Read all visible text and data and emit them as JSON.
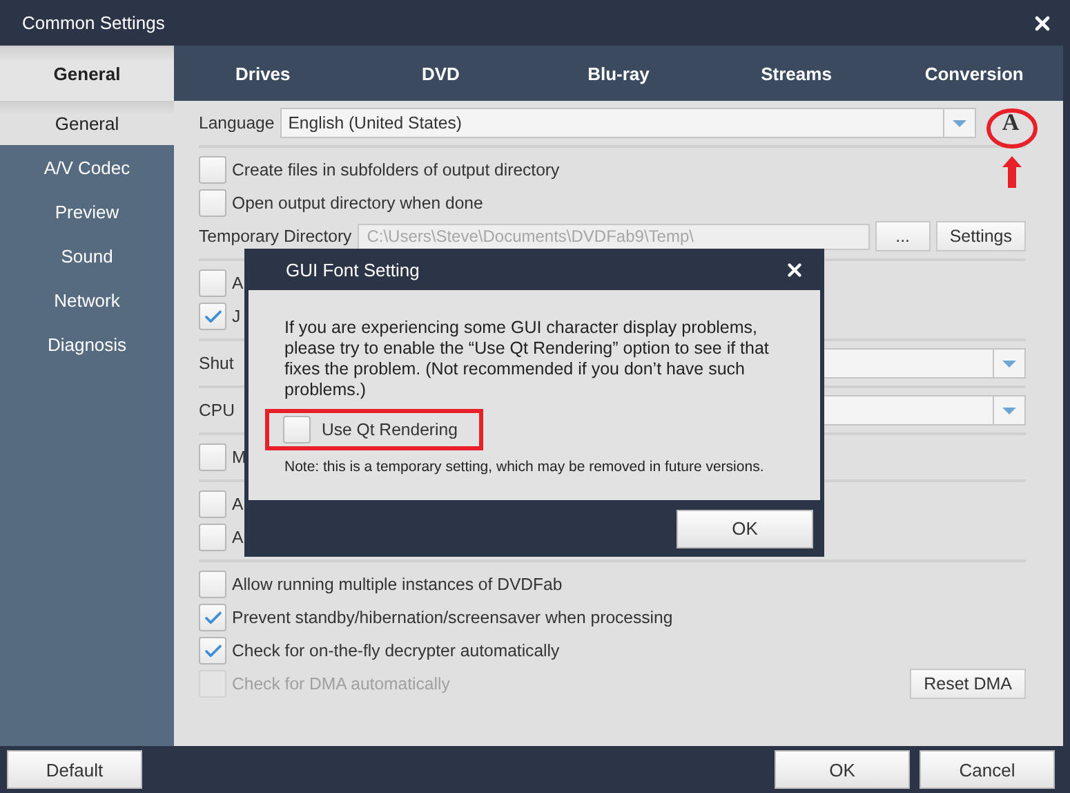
{
  "window": {
    "title": "Common Settings"
  },
  "tabs": [
    {
      "label": "General",
      "selected": true
    },
    {
      "label": "Drives",
      "selected": false
    },
    {
      "label": "DVD",
      "selected": false
    },
    {
      "label": "Blu-ray",
      "selected": false
    },
    {
      "label": "Streams",
      "selected": false
    },
    {
      "label": "Conversion",
      "selected": false
    }
  ],
  "sidebar": {
    "items": [
      {
        "label": "General",
        "selected": true
      },
      {
        "label": "A/V Codec",
        "selected": false
      },
      {
        "label": "Preview",
        "selected": false
      },
      {
        "label": "Sound",
        "selected": false
      },
      {
        "label": "Network",
        "selected": false
      },
      {
        "label": "Diagnosis",
        "selected": false
      }
    ]
  },
  "groups": [
    [
      {
        "kind": "select",
        "label": "Language",
        "value": "English (United States)",
        "font_button": "A"
      }
    ],
    [
      {
        "kind": "checkbox",
        "label": "Create files in subfolders of output directory",
        "checked": false,
        "disabled": false
      },
      {
        "kind": "checkbox",
        "label": "Open output directory when done",
        "checked": false,
        "disabled": false
      },
      {
        "kind": "directory",
        "label": "Temporary Directory",
        "value": "C:\\Users\\Steve\\Documents\\DVDFab9\\Temp\\",
        "buttons": [
          "...",
          "Settings"
        ]
      }
    ],
    [
      {
        "kind": "checkbox",
        "label": "A",
        "checked": false,
        "disabled": false
      },
      {
        "kind": "checkbox",
        "label": "J",
        "checked": true,
        "disabled": false
      }
    ],
    [
      {
        "kind": "select",
        "label": "Shut"
      }
    ],
    [
      {
        "kind": "select",
        "label": "CPU"
      }
    ],
    [
      {
        "kind": "checkbox",
        "label": "M",
        "checked": false,
        "disabled": false
      }
    ],
    [
      {
        "kind": "checkbox",
        "label": "A",
        "checked": false,
        "disabled": false
      },
      {
        "kind": "checkbox",
        "label": "A",
        "checked": false,
        "disabled": false
      }
    ],
    [
      {
        "kind": "checkbox",
        "label": "Allow running multiple instances of DVDFab",
        "checked": false,
        "disabled": false
      },
      {
        "kind": "checkbox",
        "label": "Prevent standby/hibernation/screensaver when processing",
        "checked": true,
        "disabled": false
      },
      {
        "kind": "checkbox",
        "label": "Check for on-the-fly decrypter automatically",
        "checked": true,
        "disabled": false
      },
      {
        "kind": "checkbox",
        "label": "Check for DMA automatically",
        "checked": false,
        "disabled": true,
        "button": "Reset DMA"
      }
    ]
  ],
  "dialog": {
    "title": "GUI Font Setting",
    "message": "If you are experiencing some GUI character display problems, please try to enable the “Use Qt Rendering” option to see if that fixes the problem. (Not recommended if you don’t have such problems.)",
    "option": {
      "label": "Use Qt Rendering",
      "checked": false
    },
    "note": "Note: this is a temporary setting, which may be removed in future versions.",
    "button": "OK"
  },
  "footer": {
    "left_button": "Default",
    "buttons": [
      "OK",
      "Cancel"
    ]
  }
}
